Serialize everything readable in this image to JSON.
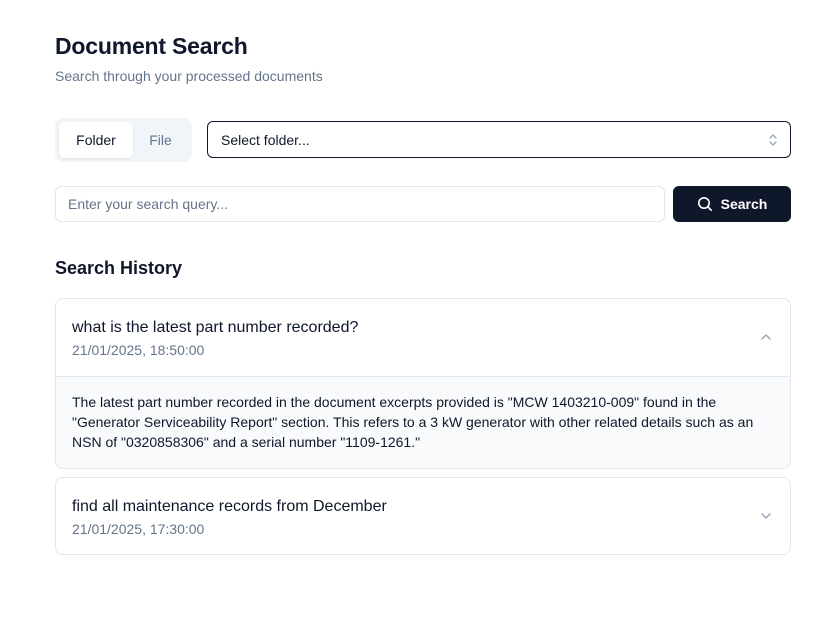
{
  "header": {
    "title": "Document Search",
    "subtitle": "Search through your processed documents"
  },
  "source_toggle": {
    "options": [
      "Folder",
      "File"
    ],
    "selected": "Folder"
  },
  "folder_select": {
    "value": "Select folder..."
  },
  "search": {
    "placeholder": "Enter your search query...",
    "value": "",
    "button_label": "Search"
  },
  "history": {
    "title": "Search History",
    "items": [
      {
        "query": "what is the latest part number recorded?",
        "timestamp": "21/01/2025, 18:50:00",
        "expanded": true,
        "answer": "The latest part number recorded in the document excerpts provided is \"MCW 1403210-009\" found in the \"Generator Serviceability Report\" section. This refers to a 3 kW generator with other related details such as an NSN of \"0320858306\" and a serial number \"1109-1261.\""
      },
      {
        "query": "find all maintenance records from December",
        "timestamp": "21/01/2025, 17:30:00",
        "expanded": false
      }
    ]
  },
  "icons": {
    "search_button": "search-icon",
    "select": "chevrons-up-down-icon",
    "expanded_item": "chevron-up-icon",
    "collapsed_item": "chevron-down-icon"
  },
  "colors": {
    "primary": "#0f172a",
    "muted_text": "#64748b",
    "border": "#e2e8f0",
    "toggle_bg": "#f1f5f9",
    "answer_bg": "#f8fafc"
  }
}
